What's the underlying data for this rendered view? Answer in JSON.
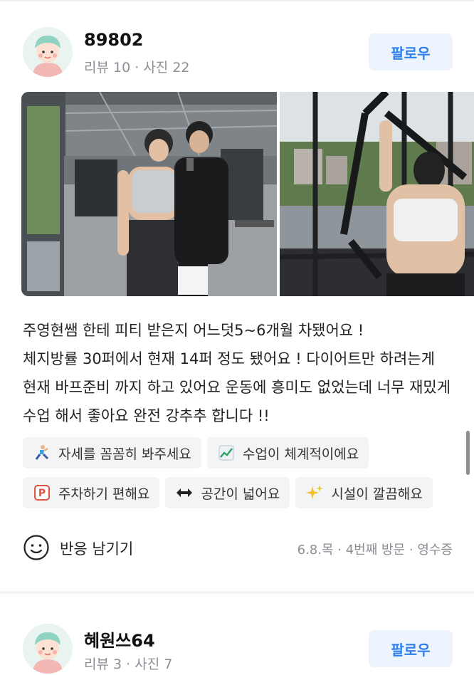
{
  "reviews": [
    {
      "user": {
        "name": "89802",
        "reviews_label": "리뷰 10",
        "photos_label": "사진 22"
      },
      "follow_label": "팔로우",
      "text": "주영현쌤 한테 피티 받은지 어느덧5~6개월 차됐어요 !\n체지방률 30퍼에서 현재 14퍼 정도 됐어요 ! 다이어트만 하려는게 현재 바프준비 까지 하고 있어요 운동에 흥미도 없었는데 너무 재밌게 수업 해서 좋아요 완전 강추추 합니다 !!",
      "tags": [
        {
          "icon": "person-stretching-icon",
          "label": "자세를 꼼꼼히 봐주세요"
        },
        {
          "icon": "chart-increasing-icon",
          "label": "수업이 체계적이에요"
        },
        {
          "icon": "parking-icon",
          "label": "주차하기 편해요"
        },
        {
          "icon": "left-right-arrow-icon",
          "label": "공간이 넓어요"
        },
        {
          "icon": "sparkles-icon",
          "label": "시설이 깔끔해요"
        }
      ],
      "react_label": "반응 남기기",
      "visit": {
        "date": "6.8.목",
        "count": "4번째 방문",
        "proof": "영수증"
      }
    },
    {
      "user": {
        "name": "혜원쓰64",
        "reviews_label": "리뷰 3",
        "photos_label": "사진 7"
      },
      "follow_label": "팔로우"
    }
  ],
  "colors": {
    "accent": "#2f80ed",
    "follow_bg": "#edf4fd",
    "chip_bg": "#f3f4f6",
    "muted": "#8b8f96"
  }
}
